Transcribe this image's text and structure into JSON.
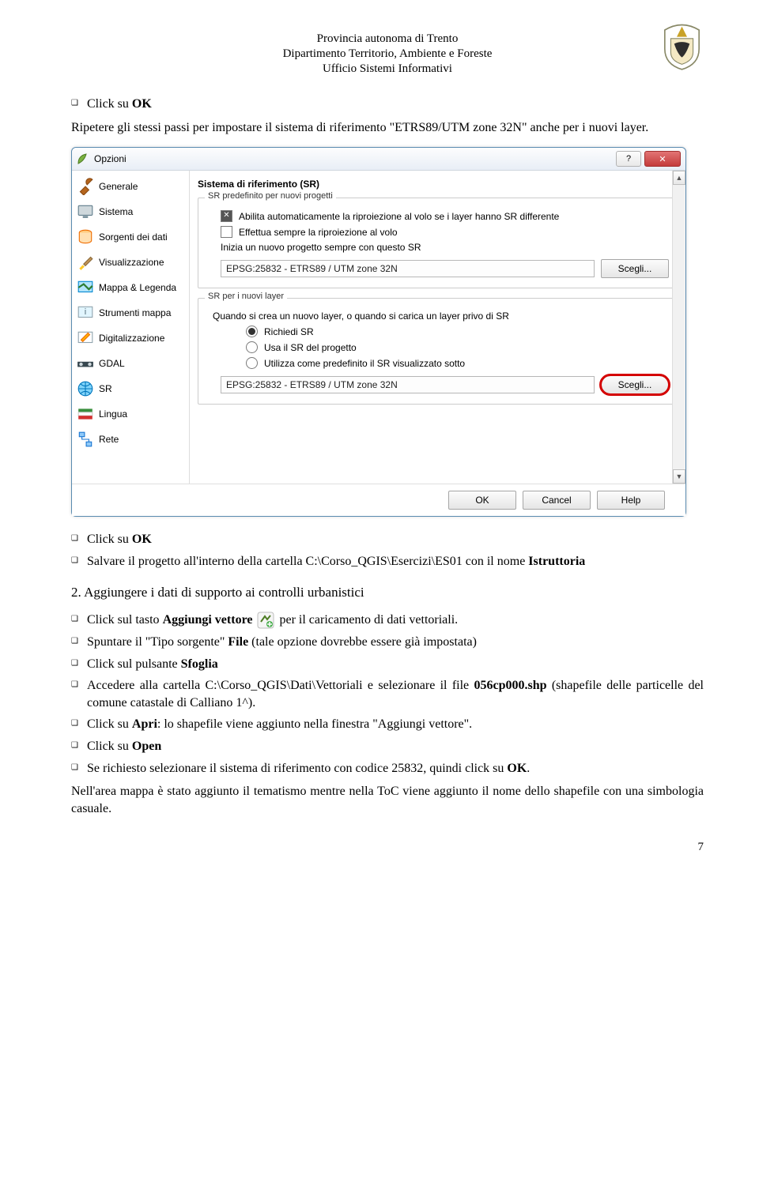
{
  "header": {
    "line1": "Provincia autonoma di Trento",
    "line2": "Dipartimento Territorio, Ambiente e Foreste",
    "line3": "Ufficio Sistemi Informativi"
  },
  "intro": {
    "click_ok_prefix": "Click su ",
    "click_ok": "OK",
    "ripetere": "Ripetere gli stessi passi per impostare il sistema di riferimento \"ETRS89/UTM zone 32N\" anche per i nuovi layer."
  },
  "dialog": {
    "title": "Opzioni",
    "section_title": "Sistema di riferimento (SR)",
    "sidebar": [
      "Generale",
      "Sistema",
      "Sorgenti dei dati",
      "Visualizzazione",
      "Mappa & Legenda",
      "Strumenti mappa",
      "Digitalizzazione",
      "GDAL",
      "SR",
      "Lingua",
      "Rete"
    ],
    "group1": {
      "legend": "SR predefinito per nuovi progetti",
      "chk1": "Abilita automaticamente la riproiezione al volo se i layer hanno SR differente",
      "chk2": "Effettua sempre la riproiezione al volo",
      "label": "Inizia un nuovo progetto sempre con questo SR",
      "value": "EPSG:25832 - ETRS89 / UTM zone 32N",
      "btn": "Scegli..."
    },
    "group2": {
      "legend": "SR per i nuovi layer",
      "desc": "Quando si crea un nuovo layer, o quando si carica un layer privo di SR",
      "r1": "Richiedi SR",
      "r2": "Usa il SR del progetto",
      "r3": "Utilizza come predefinito il SR visualizzato sotto",
      "value": "EPSG:25832 - ETRS89 / UTM zone 32N",
      "btn": "Scegli..."
    },
    "footer": {
      "ok": "OK",
      "cancel": "Cancel",
      "help": "Help"
    }
  },
  "after": {
    "save_prefix": "Salvare il progetto all'interno della cartella C:\\Corso_QGIS\\Esercizi\\ES01 con il nome ",
    "save_name": "Istruttoria",
    "heading_num": "2.",
    "heading": "Aggiungere i dati di supporto ai controlli urbanistici",
    "b1a": "Click sul tasto ",
    "b1b": "Aggiungi vettore",
    "b1c": " per il caricamento di dati vettoriali.",
    "b2a": "Spuntare il \"Tipo sorgente\" ",
    "b2b": "File",
    "b2c": " (tale opzione dovrebbe essere già impostata)",
    "b3a": "Click sul pulsante ",
    "b3b": "Sfoglia",
    "b4a": "Accedere alla cartella C:\\Corso_QGIS\\Dati\\Vettoriali e selezionare il file ",
    "b4b": "056cp000.shp",
    "b4c": " (shapefile delle particelle del comune catastale di Calliano 1^).",
    "b5a": "Click su ",
    "b5b": "Apri",
    "b5c": ": lo shapefile viene aggiunto nella finestra \"Aggiungi vettore\".",
    "b6a": "Click su ",
    "b6b": "Open",
    "b7a": "Se richiesto selezionare il sistema di riferimento con codice 25832, quindi click su ",
    "b7b": "OK",
    "b7c": ".",
    "final": "Nell'area mappa è stato aggiunto il tematismo mentre nella ToC viene aggiunto il nome dello shapefile con una simbologia casuale."
  },
  "page_number": "7"
}
